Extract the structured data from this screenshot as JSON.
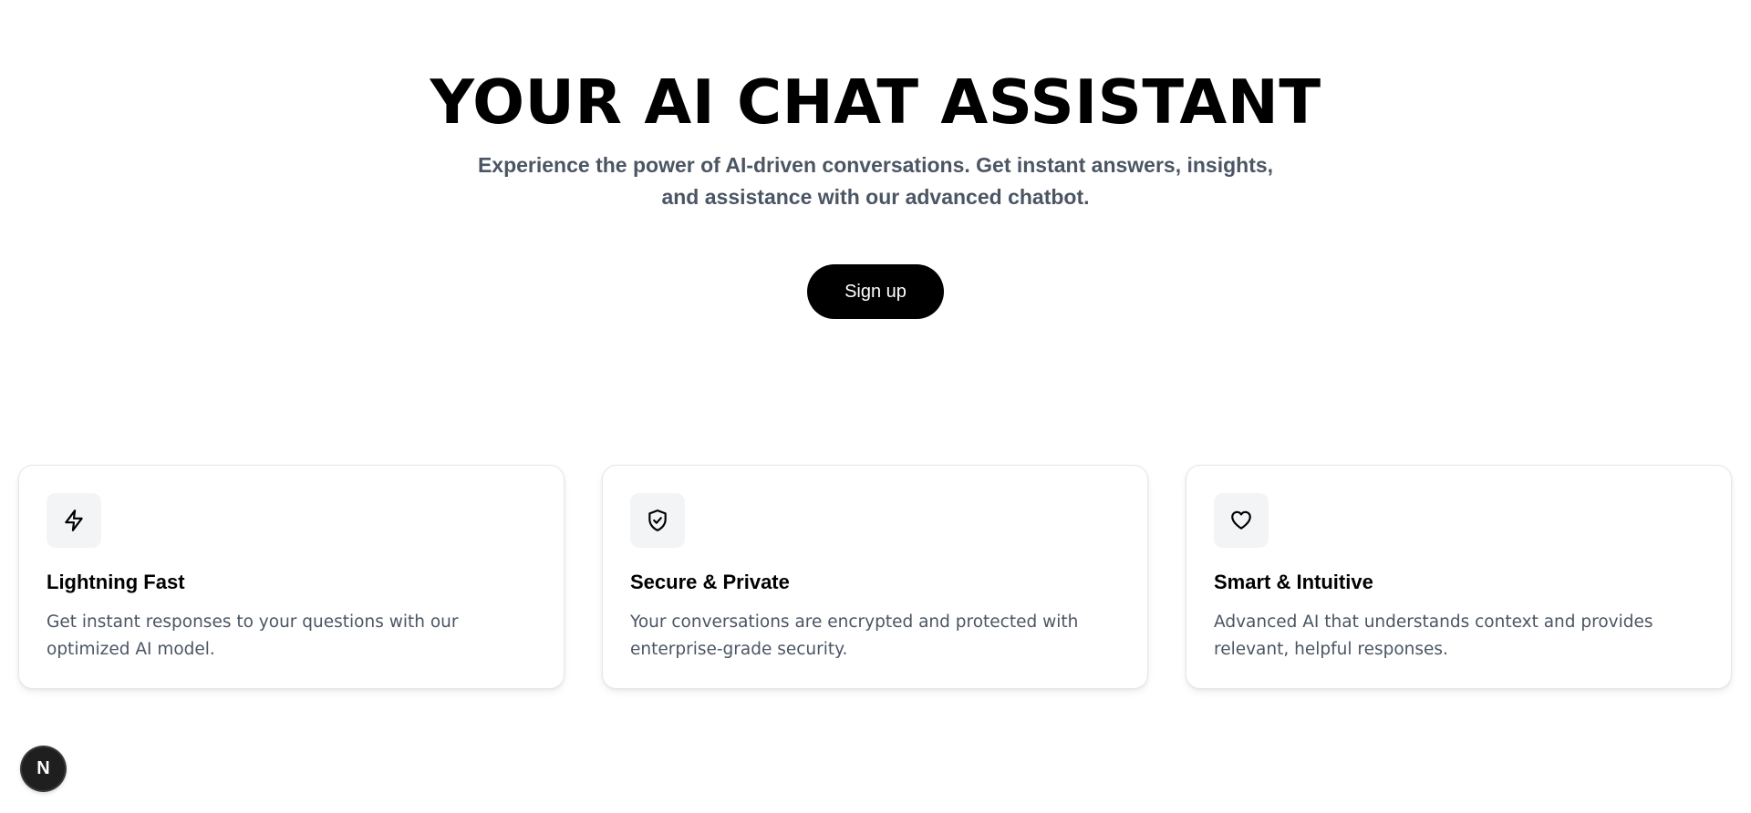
{
  "hero": {
    "title": "YOUR AI CHAT ASSISTANT",
    "subtitle_line1": "Experience the power of AI-driven conversations. Get instant answers, insights,",
    "subtitle_line2": "and assistance with our advanced chatbot.",
    "signup_label": "Sign up"
  },
  "features": [
    {
      "icon": "lightning-icon",
      "title": "Lightning Fast",
      "text": "Get instant responses to your questions with our optimized AI model."
    },
    {
      "icon": "shield-check-icon",
      "title": "Secure & Private",
      "text": "Your conversations are encrypted and protected with enterprise-grade security."
    },
    {
      "icon": "heart-icon",
      "title": "Smart & Intuitive",
      "text": "Advanced AI that understands context and provides relevant, helpful responses."
    }
  ],
  "dev_badge": {
    "label": "N"
  },
  "colors": {
    "accent": "#000000",
    "muted_text": "#4b5563",
    "icon_bg": "#f3f4f6",
    "card_border": "#e5e7eb"
  }
}
